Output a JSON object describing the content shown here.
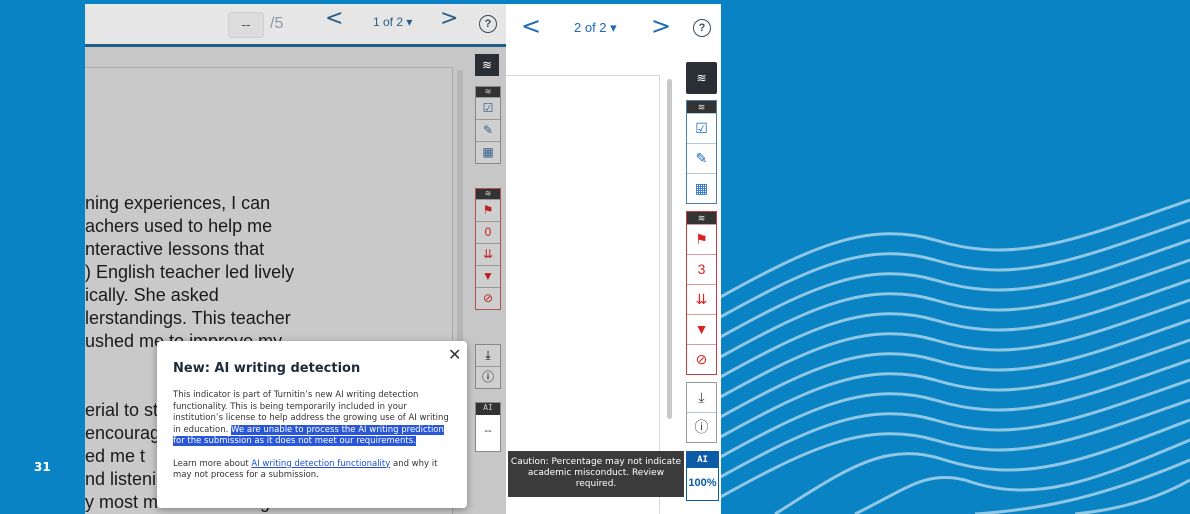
{
  "slide": {
    "number": "31"
  },
  "left_viewer": {
    "page_input": "--",
    "page_total": "/5",
    "prev": "<",
    "next": ">",
    "submission_of": "1 of 2 ▾",
    "help": "?",
    "doc_lines": [
      "ning experiences, I can",
      "achers used to help me",
      "nteractive lessons that",
      ") English teacher led lively",
      "ically. She asked",
      "lerstandings. This teacher",
      "ushed me to improve my",
      "erial to st",
      "encourag",
      "ed me t",
      "nd listeni",
      "y most memorable English"
    ],
    "match_count": "0",
    "ai_label": "AI",
    "ai_value": "--"
  },
  "popup": {
    "title": "New: AI writing detection",
    "close": "✕",
    "para1_plain": "This indicator is part of Turnitin’s new AI writing detection functionality. This is being temporarily included in your institution’s license to help address the growing use of AI writing in education. ",
    "para1_highlight": "We are unable to process the AI writing prediction for the submission as it does not meet our requirements.",
    "para2_before": "Learn more about ",
    "para2_link": "AI writing detection functionality",
    "para2_after": " and why it may not process for a submission."
  },
  "right_viewer": {
    "prev": "<",
    "next": ">",
    "submission_of": "2 of 2 ▾",
    "help": "?",
    "match_count": "3",
    "tooltip": "Caution: Percentage may not indicate academic misconduct. Review required.",
    "ai_label": "AI",
    "ai_value": "100%"
  },
  "colors": {
    "background": "#0a83c4",
    "accent": "#0d5aa7",
    "highlight": "#2a57d8",
    "flag_red": "#d22222"
  },
  "icons": [
    "layers-icon",
    "check-icon",
    "edit-icon",
    "grid-icon",
    "flag-icon",
    "sort-icon",
    "filter-icon",
    "block-icon",
    "download-icon",
    "info-icon"
  ]
}
